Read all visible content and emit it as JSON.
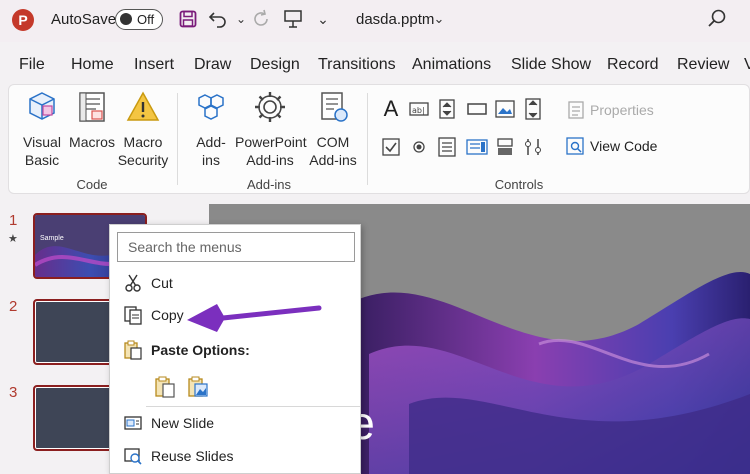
{
  "titlebar": {
    "app_logo": "P",
    "autosave_label": "AutoSave",
    "autosave_state": "Off",
    "filename": "dasda.pptm",
    "icons": [
      "save-icon",
      "undo-icon",
      "redo-icon",
      "present-icon",
      "customize-icon",
      "search-icon"
    ]
  },
  "tabs": [
    "File",
    "Home",
    "Insert",
    "Draw",
    "Design",
    "Transitions",
    "Animations",
    "Slide Show",
    "Record",
    "Review",
    "V"
  ],
  "ribbon": {
    "code": {
      "label": "Code",
      "visual_basic": "Visual\nBasic",
      "macros": "Macros",
      "macro_security": "Macro\nSecurity"
    },
    "addins": {
      "label": "Add-ins",
      "addins": "Add-\nins",
      "ppt_addins": "PowerPoint\nAdd-ins",
      "com_addins": "COM\nAdd-ins"
    },
    "controls": {
      "label": "Controls",
      "properties": "Properties",
      "view_code": "View Code"
    }
  },
  "slides": [
    {
      "number": "1",
      "thumb_text": "Sample"
    },
    {
      "number": "2"
    },
    {
      "number": "3"
    }
  ],
  "main_slide": {
    "partial_title": "le"
  },
  "context_menu": {
    "search_placeholder": "Search the menus",
    "cut": "Cut",
    "copy": "Copy",
    "paste_options": "Paste Options:",
    "new_slide": "New Slide",
    "reuse_slides": "Reuse Slides"
  },
  "colors": {
    "accent": "#7b2fbe",
    "brand": "#c4392a",
    "thumb_border": "#8b1f1f"
  }
}
